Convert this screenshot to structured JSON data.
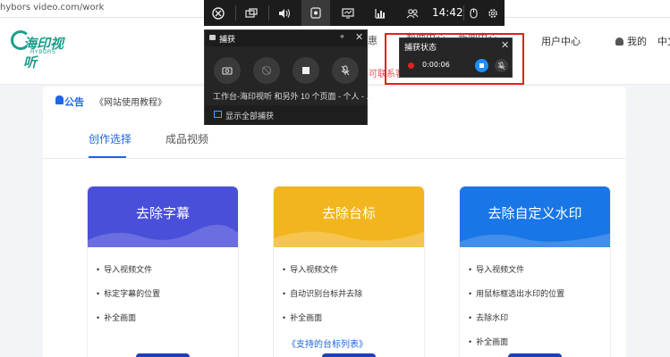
{
  "browser": {
    "url": "hybors video.com/work"
  },
  "site": {
    "logo_name": "海印视听",
    "logo_sub": "HYBORS",
    "nav": [
      "惠",
      "帮助中心",
      "新闻中心",
      "用户中心"
    ],
    "my_label": "我的",
    "lang_label": "中文",
    "hint_red": "可联系客"
  },
  "notice": {
    "label": "公告",
    "text": "《网站使用教程》"
  },
  "tabs": {
    "create": "创作选择",
    "finished": "成品视频"
  },
  "cards": [
    {
      "title": "去除字幕",
      "color": "#4a4fd9",
      "items": [
        "导入视频文件",
        "标定字幕的位置",
        "补全画面"
      ]
    },
    {
      "title": "去除台标",
      "color": "#f2b51e",
      "items": [
        "导入视频文件",
        "自动识别台标并去除",
        "补全画面"
      ]
    },
    {
      "title": "去除自定义水印",
      "color": "#1976e6",
      "items": [
        "导入视频文件",
        "用鼠标框选出水印的位置",
        "去除水印",
        "补全画面"
      ]
    }
  ],
  "support_link": "《支持的台标列表》",
  "gamebar": {
    "clock": "14:42",
    "icons": [
      "xbox-icon",
      "widget-icon",
      "audio-icon",
      "capture-icon",
      "performance-monitor-icon",
      "resources-icon",
      "social-icon",
      "mouse-icon",
      "settings-icon"
    ]
  },
  "capture_panel": {
    "title": "捕获",
    "info": "工作台-海印视听 和另外 10 个页面 - 个人 - ...",
    "show_all": "显示全部捕获"
  },
  "capture_status": {
    "title": "捕获状态",
    "time": "0:00:06",
    "accent": "#1e8fff",
    "record_color": "#e02020"
  }
}
